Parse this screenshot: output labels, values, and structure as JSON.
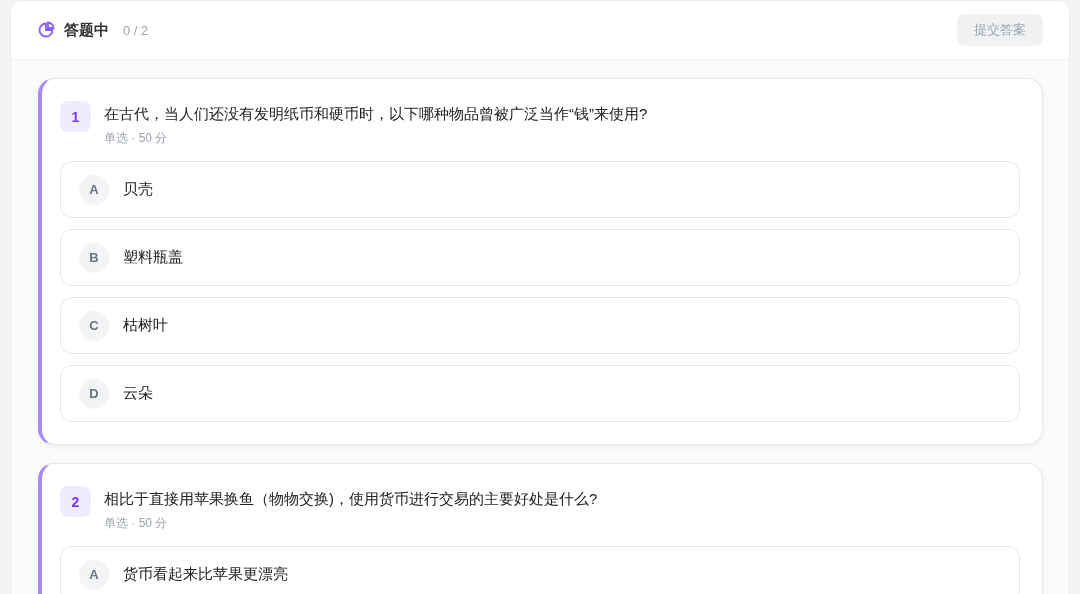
{
  "header": {
    "status": "答题中",
    "progress": "0 / 2",
    "submit_button": {
      "label": "提交答案",
      "disabled": true
    }
  },
  "questions": [
    {
      "number": "1",
      "text": "在古代，当人们还没有发明纸币和硬币时，以下哪种物品曾被广泛当作“钱”来使用?",
      "meta": "单选 · 50 分",
      "options": [
        {
          "letter": "A",
          "text": "贝壳",
          "selected": false
        },
        {
          "letter": "B",
          "text": "塑料瓶盖",
          "selected": false
        },
        {
          "letter": "C",
          "text": "枯树叶",
          "selected": false
        },
        {
          "letter": "D",
          "text": "云朵",
          "selected": false
        }
      ]
    },
    {
      "number": "2",
      "text": "相比于直接用苹果换鱼（物物交换)，使用货币进行交易的主要好处是什么?",
      "meta": "单选 · 50 分",
      "options": [
        {
          "letter": "A",
          "text": "货币看起来比苹果更漂亮",
          "selected": false
        }
      ]
    }
  ]
}
